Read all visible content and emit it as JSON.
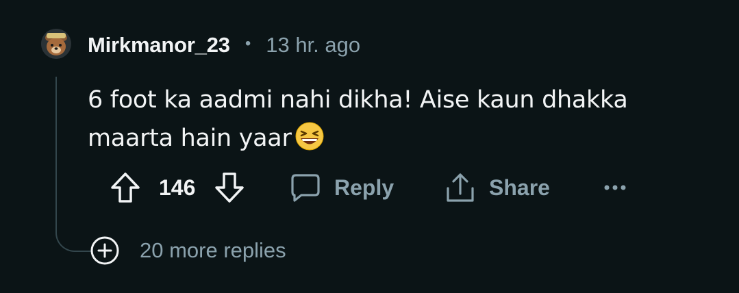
{
  "comment": {
    "username": "Mirkmanor_23",
    "separator": "•",
    "timestamp": "13 hr. ago",
    "body_line1": "6 foot ka aadmi nahi dikha! Aise kaun dhakka",
    "body_line2": "maarta hain yaar",
    "emoji": "grinning-squinting-face"
  },
  "actions": {
    "upvote_icon": "arrow-up-icon",
    "score": "146",
    "downvote_icon": "arrow-down-icon",
    "reply_label": "Reply",
    "share_label": "Share",
    "more_icon": "ellipsis-icon"
  },
  "thread": {
    "more_replies_label": "20 more replies"
  },
  "colors": {
    "background": "#0b1416",
    "primary_text": "#f2f4f5",
    "secondary_text": "#8ba2ad",
    "thread_line": "#33464c"
  }
}
